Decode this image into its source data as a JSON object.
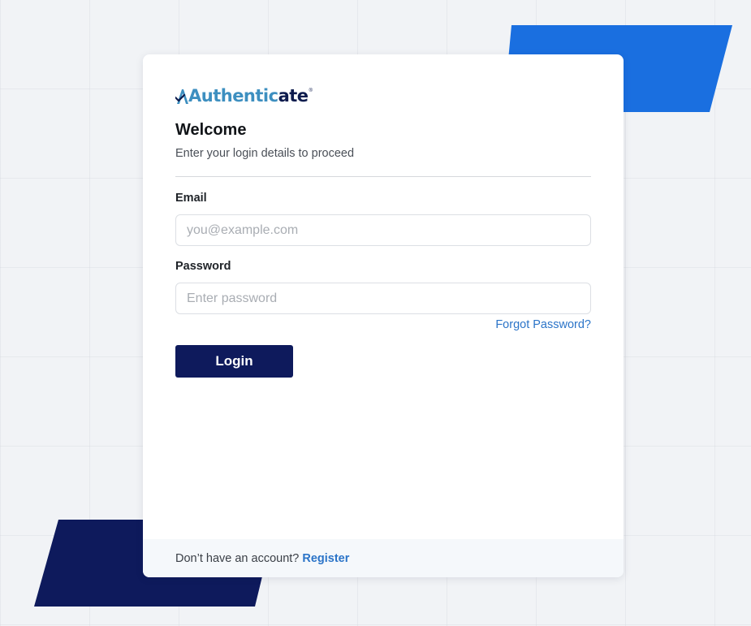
{
  "brand": {
    "logo_text_light": "Authentic",
    "logo_text_dark": "ate",
    "logo_mark": "®",
    "colors": {
      "brand_light": "#3d8fc0",
      "brand_dark": "#0d1b4d",
      "accent_blue": "#1a6fe0",
      "navy": "#0e1a5c",
      "link": "#2b74c8"
    }
  },
  "login_form": {
    "title": "Welcome",
    "subtitle": "Enter your login details to proceed",
    "email_label": "Email",
    "email_placeholder": "you@example.com",
    "email_value": "",
    "password_label": "Password",
    "password_placeholder": "Enter password",
    "password_value": "",
    "forgot_password_label": "Forgot Password?",
    "login_button_label": "Login"
  },
  "footer": {
    "prompt_text": "Don’t have an account?",
    "register_label": "Register"
  }
}
